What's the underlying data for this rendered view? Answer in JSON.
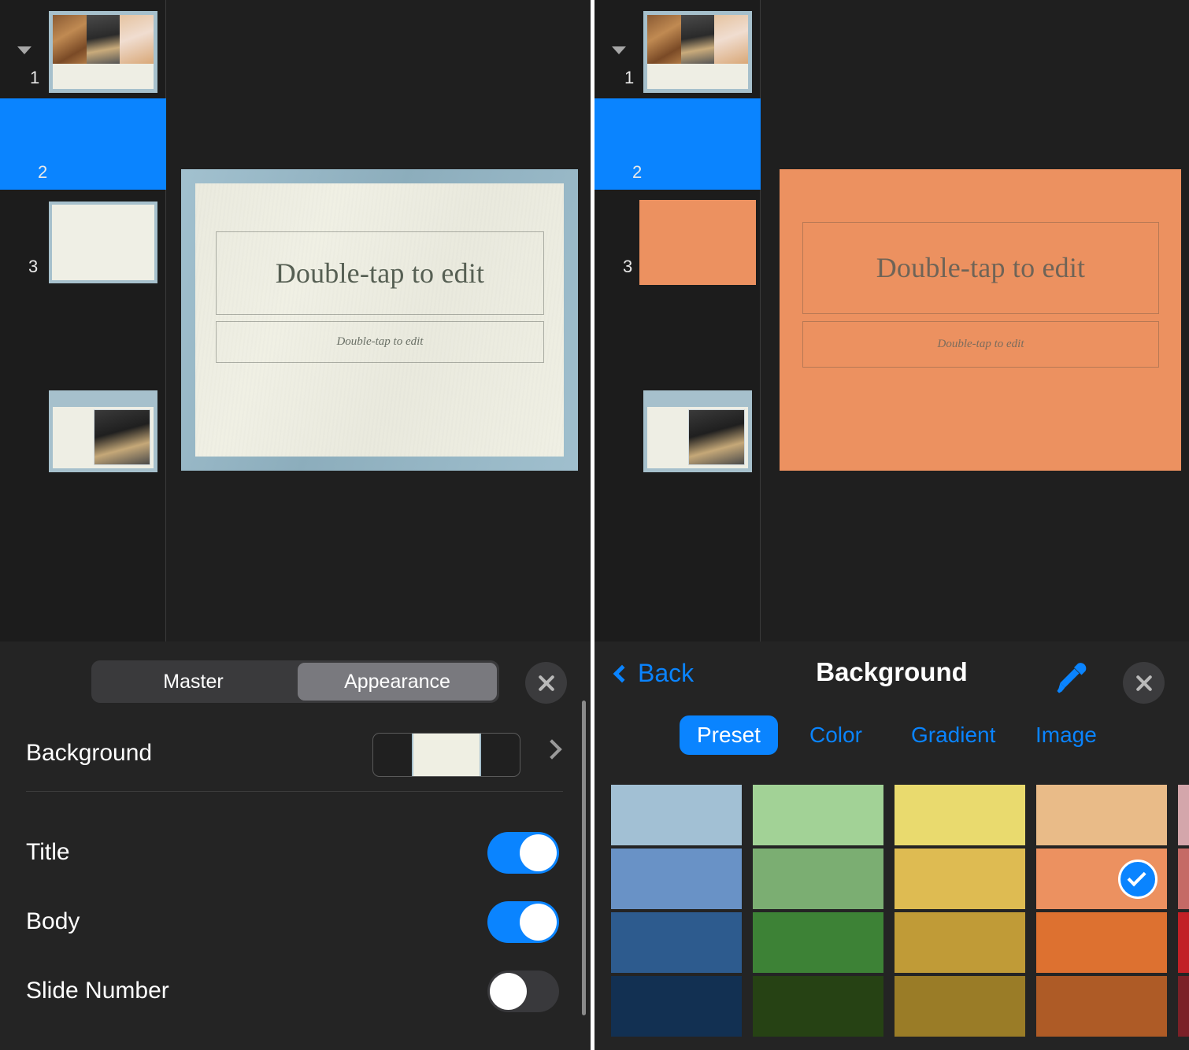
{
  "app": {
    "slide_placeholder_title": "Double-tap to edit",
    "slide_placeholder_body": "Double-tap to edit"
  },
  "slides": [
    {
      "number": "1"
    },
    {
      "number": "2"
    },
    {
      "number": "3"
    }
  ],
  "left_panel": {
    "segmented": {
      "options": [
        "Master",
        "Appearance"
      ],
      "selected": "Appearance"
    },
    "background_row": {
      "label": "Background",
      "swatch_color": "#efefe3"
    },
    "toggles": [
      {
        "label": "Title",
        "state": "on"
      },
      {
        "label": "Body",
        "state": "on"
      },
      {
        "label": "Slide Number",
        "state": "off"
      }
    ],
    "close_icon": "close-icon"
  },
  "right_panel": {
    "back_label": "Back",
    "title": "Background",
    "eyedropper_icon": "eyedropper-icon",
    "close_icon": "close-icon",
    "tabs": {
      "options": [
        "Preset",
        "Color",
        "Gradient",
        "Image"
      ],
      "selected": "Preset"
    },
    "selected_swatch": "#ec9160",
    "accent_color": "#0a84ff",
    "swatch_columns": [
      {
        "name": "blue",
        "colors": [
          "#a2c0d4",
          "#6992c6",
          "#2d5b8e",
          "#123052"
        ]
      },
      {
        "name": "green",
        "colors": [
          "#a2d296",
          "#7bae72",
          "#3d8236",
          "#264214"
        ]
      },
      {
        "name": "yellow",
        "colors": [
          "#e9da6e",
          "#debb52",
          "#c09b37",
          "#9a7c27"
        ]
      },
      {
        "name": "orange",
        "colors": [
          "#e9bb88",
          "#ec9160",
          "#dd7130",
          "#ae5b26"
        ]
      },
      {
        "name": "red",
        "colors": [
          "#d4a6ab",
          "#c56a66",
          "#c22026",
          "#7b2027"
        ]
      }
    ]
  }
}
